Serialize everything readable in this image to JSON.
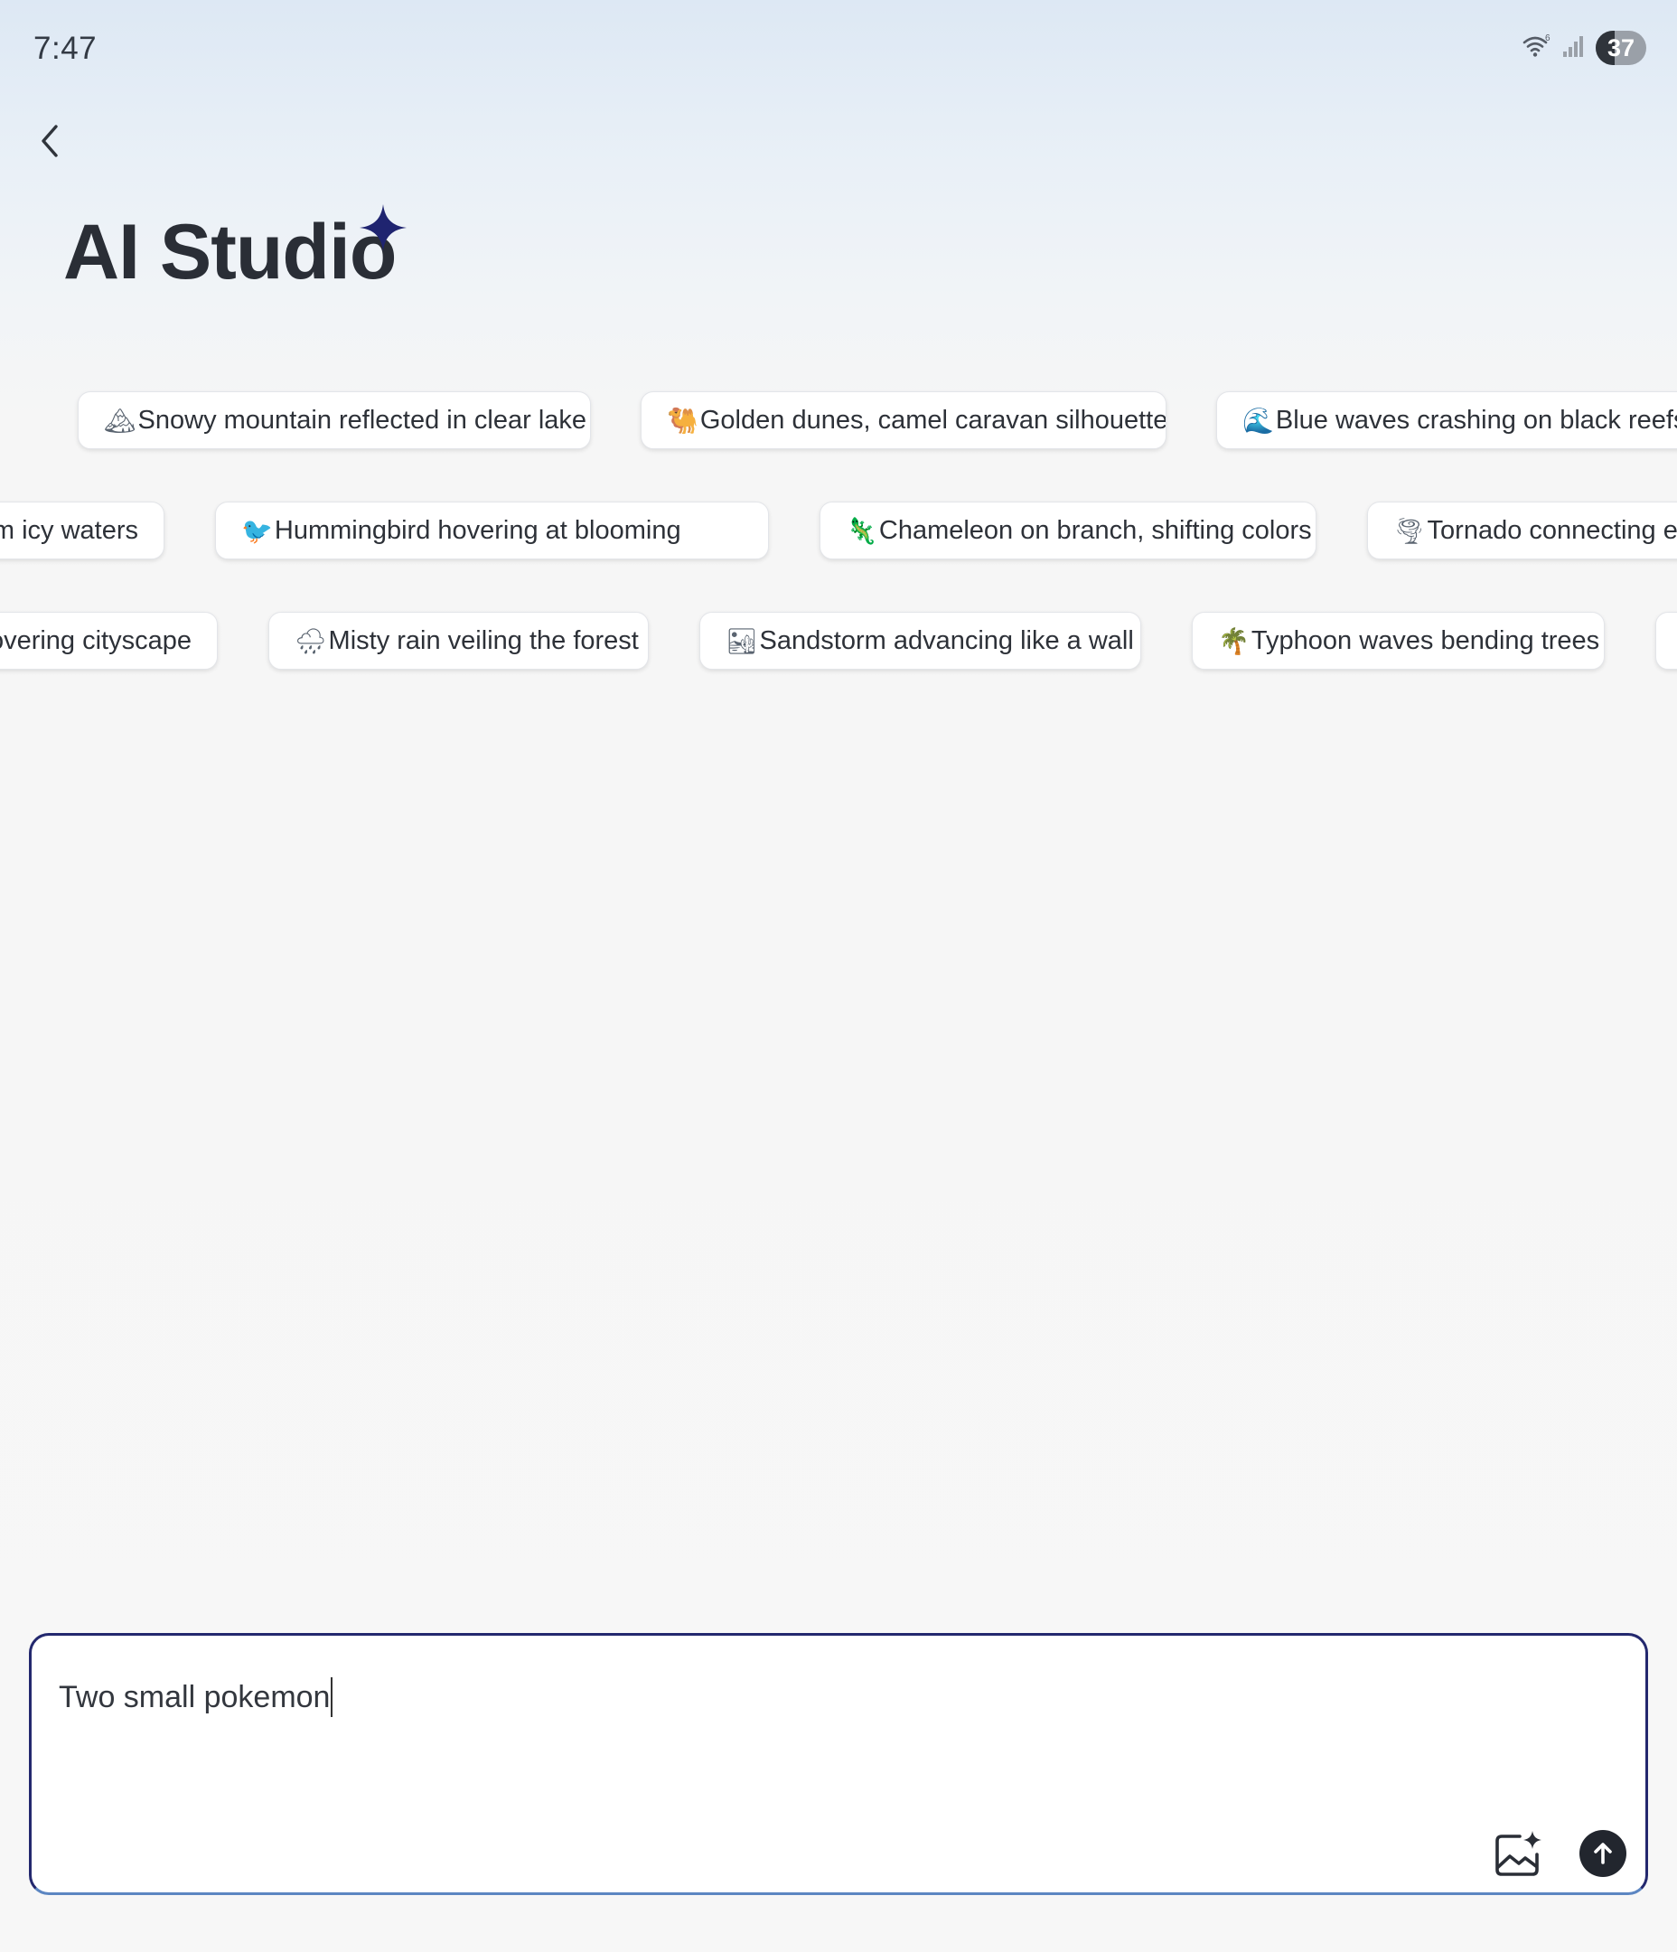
{
  "status_bar": {
    "time": "7:47",
    "battery_level": "37",
    "battery_fraction": 0.37,
    "wifi_icon": "wifi-6-icon",
    "signal_icon": "cellular-signal-icon"
  },
  "header": {
    "back_icon": "chevron-left-icon",
    "title": "AI Studio",
    "title_icon": "sparkle-icon",
    "accent_color": "#1f2470"
  },
  "suggestions": {
    "row1": [
      {
        "emoji": "🏔",
        "label": "Snowy mountain reflected in clear lake"
      },
      {
        "emoji": "🐫",
        "label": "Golden dunes, camel caravan silhouette"
      },
      {
        "emoji": "🌊",
        "label": "Blue waves crashing on black reefs"
      }
    ],
    "row2": [
      {
        "emoji": "",
        "label": "m icy waters"
      },
      {
        "emoji": "🐦",
        "label": "Hummingbird hovering at blooming"
      },
      {
        "emoji": "🦎",
        "label": "Chameleon on branch, shifting colors"
      },
      {
        "emoji": "🌪",
        "label": "Tornado connecting ea"
      }
    ],
    "row3": [
      {
        "emoji": "",
        "label": "overing cityscape"
      },
      {
        "emoji": "🌧",
        "label": "Misty rain veiling the forest"
      },
      {
        "emoji": "🏜",
        "label": "Sandstorm advancing like a wall"
      },
      {
        "emoji": "🌴",
        "label": "Typhoon waves bending trees"
      },
      {
        "emoji": "",
        "label": ""
      }
    ]
  },
  "prompt_input": {
    "value": "Two small pokemon",
    "image_button_icon": "image-sparkle-icon",
    "send_button_icon": "arrow-up-icon"
  }
}
